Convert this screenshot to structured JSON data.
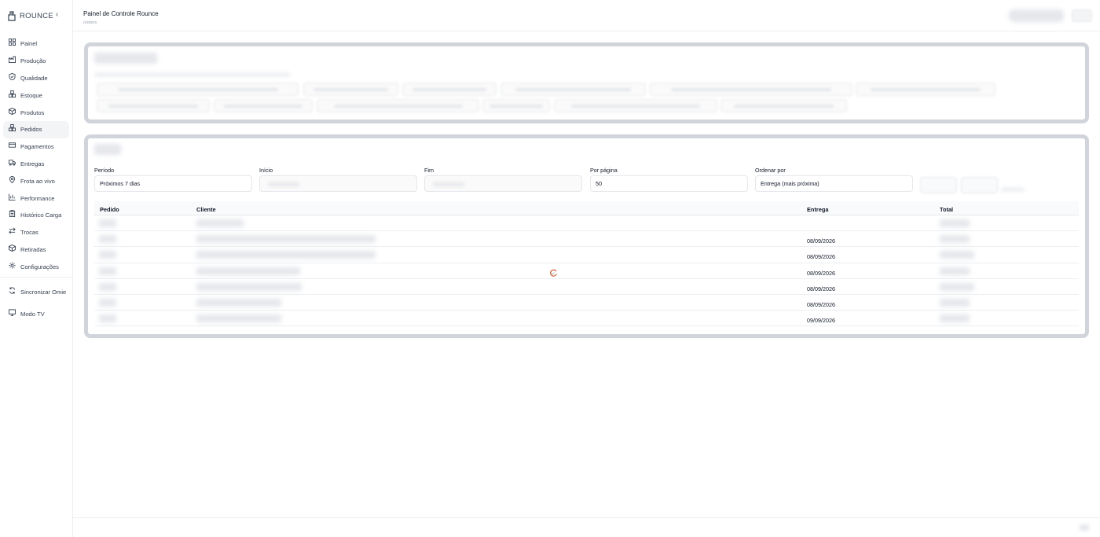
{
  "sidebar": {
    "brand": "ROUNCE",
    "collapse_icon": "chevron-left-icon",
    "items": [
      {
        "label": "Painel",
        "icon": "dashboard-grid-icon"
      },
      {
        "label": "Produção",
        "icon": "factory-icon"
      },
      {
        "label": "Qualidade",
        "icon": "shield-check-icon"
      },
      {
        "label": "Estoque",
        "icon": "boxes-icon"
      },
      {
        "label": "Produtos",
        "icon": "package-icon"
      },
      {
        "label": "Pedidos",
        "icon": "boxes-icon"
      },
      {
        "label": "Pagamentos",
        "icon": "credit-card-icon"
      },
      {
        "label": "Entregas",
        "icon": "truck-icon"
      },
      {
        "label": "Frota ao vivo",
        "icon": "map-pin-icon"
      },
      {
        "label": "Performance",
        "icon": "bar-chart-icon"
      },
      {
        "label": "Histórico Carga",
        "icon": "clipboard-icon"
      },
      {
        "label": "Trocas",
        "icon": "arrows-swap-icon"
      },
      {
        "label": "Retiradas",
        "icon": "package-icon"
      },
      {
        "label": "Configurações",
        "icon": "gear-icon"
      }
    ],
    "active_index": 5,
    "sync": {
      "label": "Sincronizar Omie",
      "icon": "refresh-icon"
    },
    "tv": {
      "label": "Modo TV",
      "icon": "monitor-icon"
    }
  },
  "header": {
    "title": "Painel de Controle Rounce",
    "route": "/orders"
  },
  "filters": {
    "period_label": "Período",
    "period_value": "Próximos 7 dias",
    "start_label": "Início",
    "end_label": "Fim",
    "per_page_label": "Por página",
    "per_page_value": "50",
    "sort_label": "Ordenar por",
    "sort_value": "Entrega (mais próxima)"
  },
  "table": {
    "columns": [
      "Pedido",
      "Cliente",
      "Entrega",
      "Total"
    ],
    "rows": [
      {
        "entrega": ""
      },
      {
        "entrega": "08/09/2026"
      },
      {
        "entrega": "08/09/2026"
      },
      {
        "entrega": "08/09/2026"
      },
      {
        "entrega": "08/09/2026"
      },
      {
        "entrega": "08/09/2026"
      },
      {
        "entrega": "09/09/2026"
      }
    ]
  },
  "misc": {
    "loading_icon": "spinner-icon",
    "accent": "#c2410c"
  }
}
